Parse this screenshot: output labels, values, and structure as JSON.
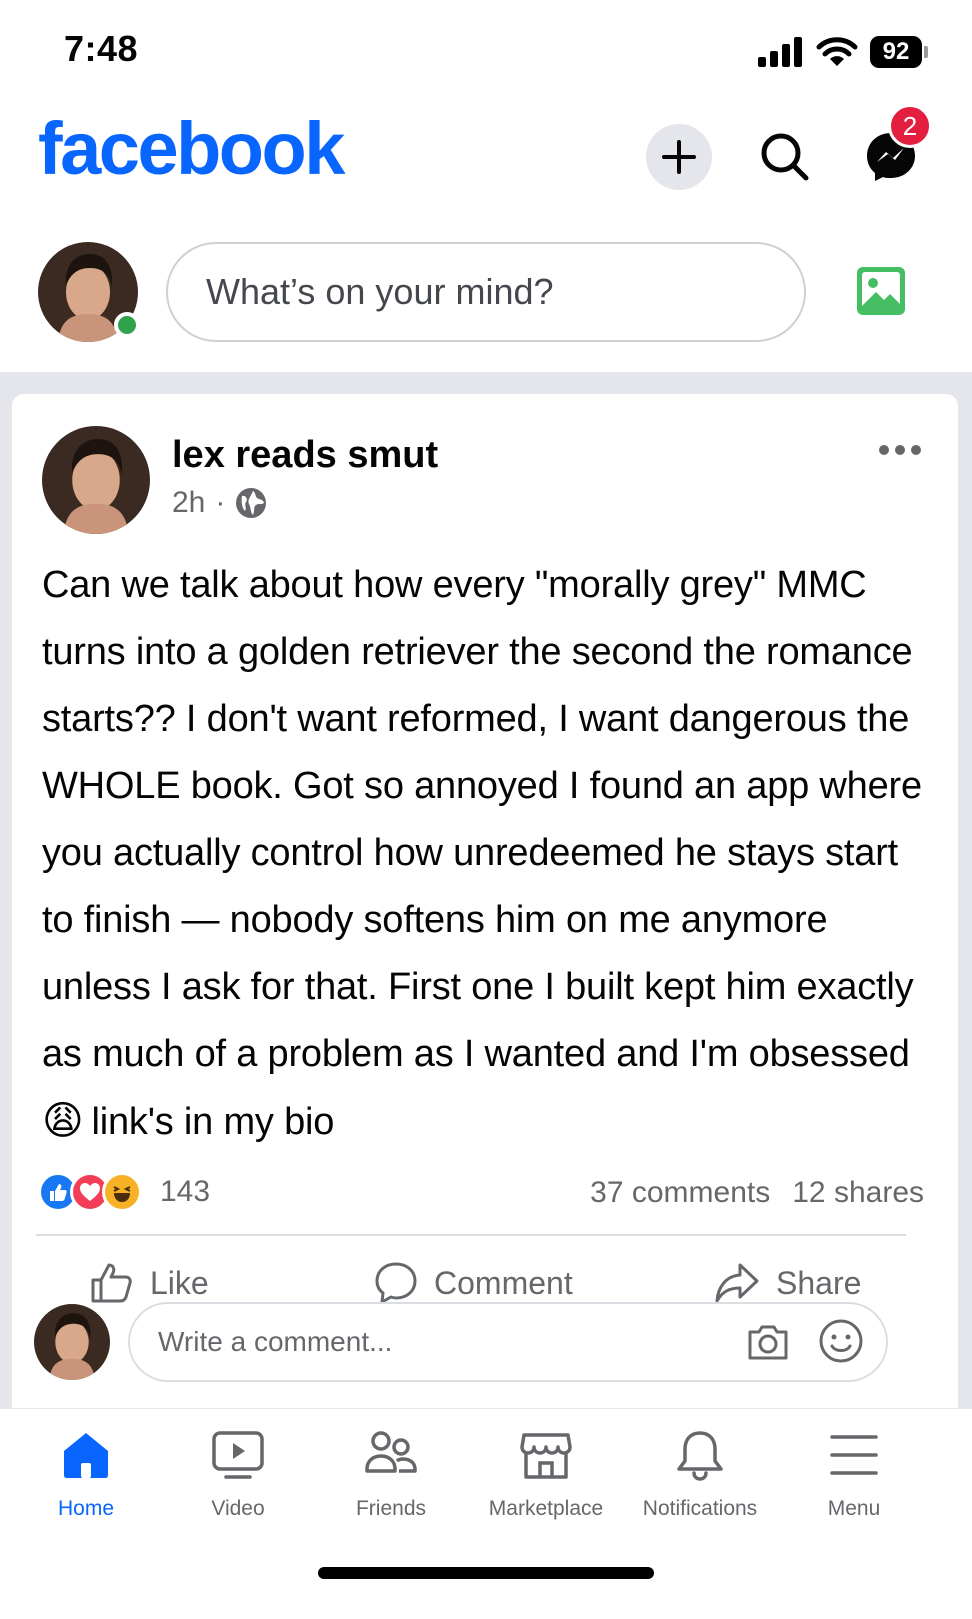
{
  "status_bar": {
    "time": "7:48",
    "battery": "92"
  },
  "header": {
    "logo": "facebook",
    "messenger_badge": "2"
  },
  "composer": {
    "placeholder": "What’s on your mind?"
  },
  "post": {
    "author": "lex reads smut",
    "time": "2h",
    "separator": "·",
    "text": "Can we talk about how every \"morally grey\" MMC turns into a golden retriever the second the romance starts?? I don't want reformed, I want dangerous the WHOLE book. Got so annoyed I found an app where you actually control how unredeemed he stays start to finish — nobody softens him on me anymore unless I ask for that. First one I built kept him exactly as much of a problem as I wanted and I'm obsessed",
    "text_emoji": "😩",
    "text_tail": "link's in my bio",
    "reaction_count": "143",
    "comments": "37 comments",
    "shares": "12 shares",
    "actions": {
      "like": "Like",
      "comment": "Comment",
      "share": "Share"
    },
    "comment_placeholder": "Write a comment..."
  },
  "tabs": [
    {
      "label": "Home",
      "icon": "home-icon",
      "active": true
    },
    {
      "label": "Video",
      "icon": "video-icon"
    },
    {
      "label": "Friends",
      "icon": "friends-icon"
    },
    {
      "label": "Marketplace",
      "icon": "marketplace-icon"
    },
    {
      "label": "Notifications",
      "icon": "bell-icon"
    },
    {
      "label": "Menu",
      "icon": "menu-icon"
    }
  ],
  "colors": {
    "brand": "#0866ff",
    "online": "#31a24c",
    "badge": "#e41e3f"
  }
}
